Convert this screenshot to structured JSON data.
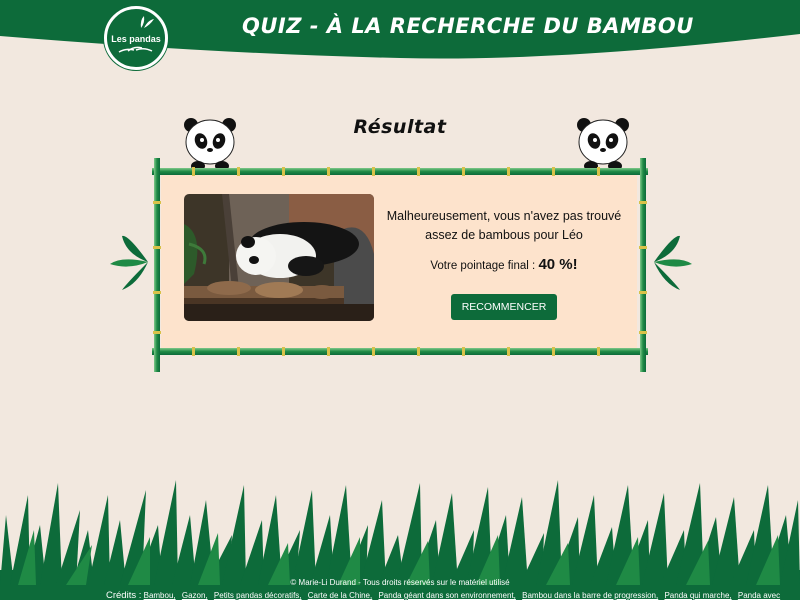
{
  "header": {
    "title": "Quiz  - à la recherche du bambou",
    "logo_text": "Les pandas"
  },
  "result": {
    "title": "Résultat",
    "message": "Malheureusement, vous n'avez pas trouvé assez de bambous pour Léo",
    "score_label": "Votre pointage final :",
    "score_value": "40 %!",
    "restart_label": "RECOMMENCER"
  },
  "footer": {
    "copyright": "© Marie-Li Durand - Tous droits réservés sur le matériel utilisé",
    "credits_label": "Crédits :",
    "credit_links": [
      "Bambou,",
      "Gazon,",
      "Petits pandas décoratifs,",
      "Carte de la Chine,",
      "Panda géant dans son environnement,",
      "Bambou dans la barre de progression,",
      "Panda qui marche,",
      "Panda avec"
    ]
  },
  "colors": {
    "brand_green": "#0d6b3a",
    "background": "#f2e8df",
    "card_background": "#fde3cc"
  },
  "icons": [
    "panda-icon",
    "bamboo-leaf-icon",
    "bamboo-frame",
    "grass-decoration"
  ]
}
